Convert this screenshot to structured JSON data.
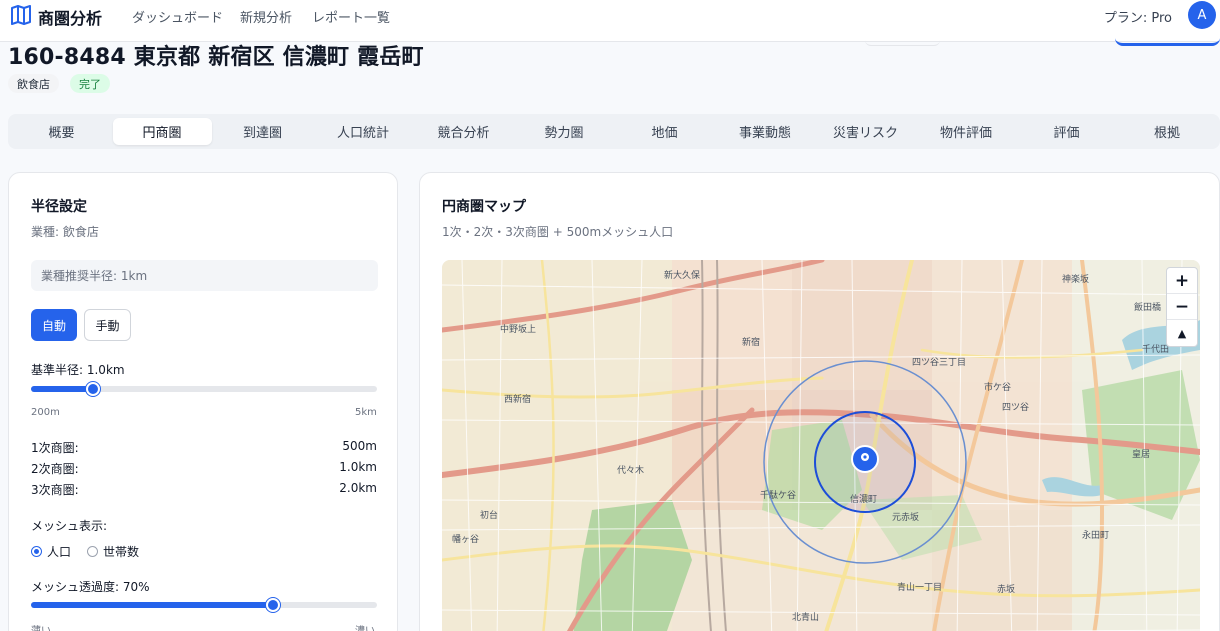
{
  "app": {
    "name": "商圏分析",
    "logo_icon": "map-book-icon"
  },
  "nav": {
    "links": [
      "ダッシュボード",
      "新規分析",
      "レポート一覧"
    ],
    "plan": "プラン: Pro",
    "avatar": "A"
  },
  "header": {
    "address": "160-8484 東京都 新宿区 信濃町 霞岳町",
    "category_badge": "飲食店",
    "status_badge": "完了"
  },
  "tabs": [
    {
      "label": "概要",
      "active": false
    },
    {
      "label": "円商圏",
      "active": true
    },
    {
      "label": "到達圏",
      "active": false
    },
    {
      "label": "人口統計",
      "active": false
    },
    {
      "label": "競合分析",
      "active": false
    },
    {
      "label": "勢力圏",
      "active": false
    },
    {
      "label": "地価",
      "active": false
    },
    {
      "label": "事業動態",
      "active": false
    },
    {
      "label": "災害リスク",
      "active": false
    },
    {
      "label": "物件評価",
      "active": false
    },
    {
      "label": "評価",
      "active": false
    },
    {
      "label": "根拠",
      "active": false
    }
  ],
  "radius_panel": {
    "title": "半径設定",
    "industry": "業種: 飲食店",
    "recommended": "業種推奨半径: 1km",
    "mode_auto": "自動",
    "mode_manual": "手動",
    "base_radius_label": "基準半径: 1.0km",
    "base_radius_fraction": 0.18,
    "slider_min": "200m",
    "slider_max": "5km",
    "areas": [
      {
        "label": "1次商圏:",
        "value": "500m"
      },
      {
        "label": "2次商圏:",
        "value": "1.0km"
      },
      {
        "label": "3次商圏:",
        "value": "2.0km"
      }
    ],
    "mesh_display_label": "メッシュ表示:",
    "mesh_options": [
      {
        "label": "人口",
        "selected": true
      },
      {
        "label": "世帯数",
        "selected": false
      }
    ],
    "opacity_label": "メッシュ透過度: 70%",
    "opacity_fraction": 0.7,
    "opacity_min": "薄い",
    "opacity_max": "濃い"
  },
  "map_panel": {
    "title": "円商圏マップ",
    "subtitle": "1次・2次・3次商圏 + 500mメッシュ人口",
    "zoom_in": "+",
    "zoom_out": "−",
    "reset_north": "▲",
    "labels": [
      "新大久保",
      "新宿",
      "西新宿",
      "代々木",
      "千駄ケ谷",
      "信濃町",
      "元赤坂",
      "四ツ谷",
      "市ケ谷",
      "千代田",
      "皇居",
      "赤坂",
      "永田町",
      "北青山",
      "青山一丁目",
      "初台",
      "幡ヶ谷",
      "中野坂上",
      "飯田橋",
      "神楽坂",
      "四ツ谷三丁目"
    ],
    "colors": {
      "primary_ring": "#2563eb",
      "secondary_ring": "#4a7fd8",
      "tertiary_ring": "#6a8fd0",
      "pin": "#2563eb"
    }
  }
}
